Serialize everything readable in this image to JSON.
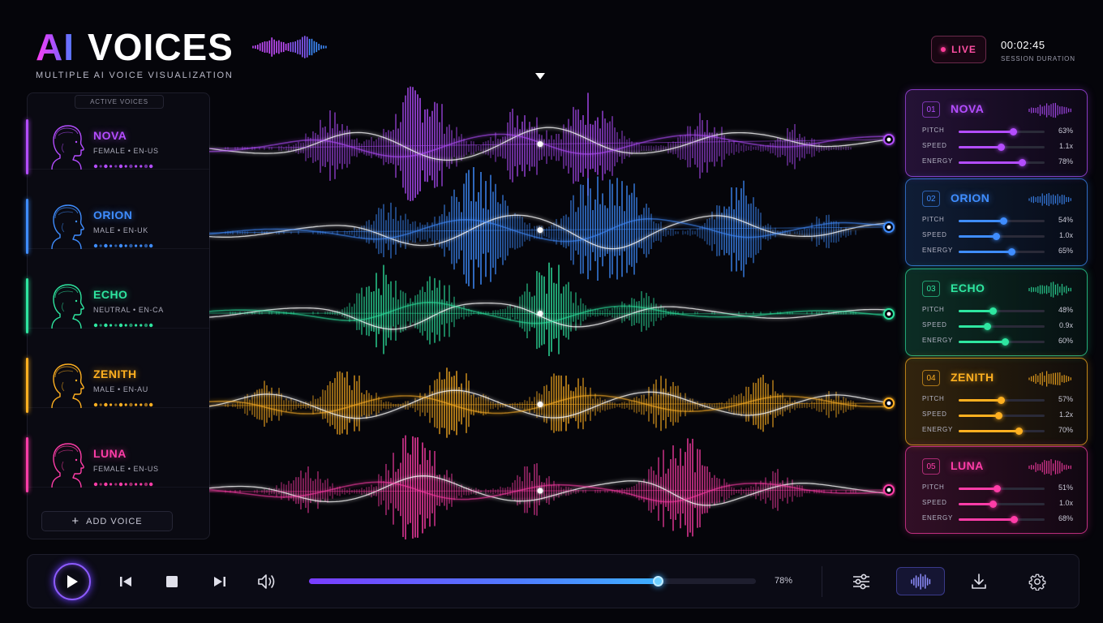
{
  "header": {
    "title_accent": "AI",
    "title_main": "VOICES",
    "subtitle": "MULTIPLE AI VOICE VISUALIZATION",
    "live_label": "LIVE",
    "session_time": "00:02:45",
    "session_label": "SESSION DURATION"
  },
  "voices_panel": {
    "label": "ACTIVE VOICES",
    "add_label": "ADD VOICE",
    "voices": [
      {
        "id": "01",
        "name": "NOVA",
        "meta": "FEMALE • EN-US",
        "color": "#b44dff",
        "pitch": "63%",
        "pitch_level": 0.63,
        "speed": "1.1x",
        "speed_level": 0.49,
        "energy": "78%",
        "energy_level": 0.74
      },
      {
        "id": "02",
        "name": "ORION",
        "meta": "MALE • EN-UK",
        "color": "#3f8dff",
        "pitch": "54%",
        "pitch_level": 0.52,
        "speed": "1.0x",
        "speed_level": 0.43,
        "energy": "65%",
        "energy_level": 0.61
      },
      {
        "id": "03",
        "name": "ECHO",
        "meta": "NEUTRAL • EN-CA",
        "color": "#2ee6a0",
        "pitch": "48%",
        "pitch_level": 0.4,
        "speed": "0.9x",
        "speed_level": 0.33,
        "energy": "60%",
        "energy_level": 0.54
      },
      {
        "id": "04",
        "name": "ZENITH",
        "meta": "MALE • EN-AU",
        "color": "#ffb020",
        "pitch": "57%",
        "pitch_level": 0.49,
        "speed": "1.2x",
        "speed_level": 0.46,
        "energy": "70%",
        "energy_level": 0.7
      },
      {
        "id": "05",
        "name": "LUNA",
        "meta": "FEMALE • EN-US",
        "color": "#ff3da8",
        "pitch": "51%",
        "pitch_level": 0.44,
        "speed": "1.0x",
        "speed_level": 0.4,
        "energy": "68%",
        "energy_level": 0.64
      }
    ]
  },
  "param_labels": {
    "pitch": "PITCH",
    "speed": "SPEED",
    "energy": "ENERGY"
  },
  "transport": {
    "progress": 0.78,
    "progress_label": "78%"
  },
  "icons": {
    "play": "play-icon",
    "previous": "skip-back-icon",
    "stop": "stop-icon",
    "next": "skip-forward-icon",
    "volume": "volume-icon",
    "mixer": "sliders-icon",
    "waveform": "waveform-icon",
    "download": "download-icon",
    "settings": "gear-icon",
    "add": "plus-icon",
    "avatar": "head-profile-icon"
  }
}
